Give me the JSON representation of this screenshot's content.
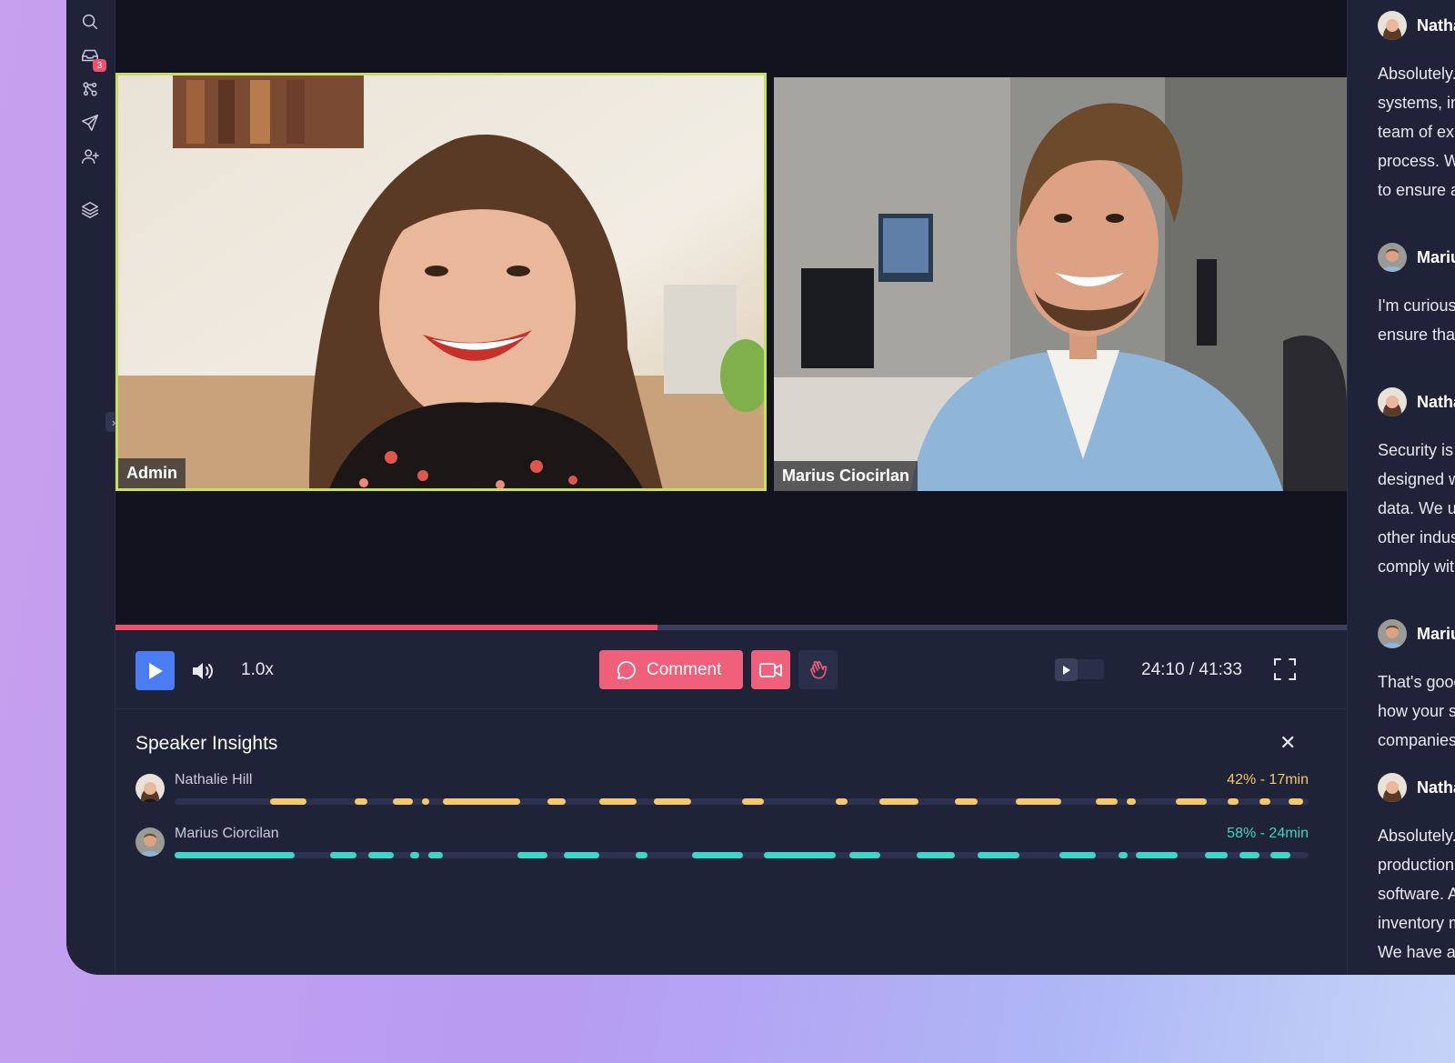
{
  "rail": {
    "inbox_badge": "3"
  },
  "video": {
    "participants": [
      {
        "name": "Admin"
      },
      {
        "name": "Marius Ciocirlan"
      }
    ],
    "progress": 0.44
  },
  "controls": {
    "speed": "1.0x",
    "comment_label": "Comment",
    "time": "24:10 / 41:33"
  },
  "insights": {
    "title": "Speaker Insights",
    "speakers": [
      {
        "name": "Nathalie Hill",
        "stat": "42% - 17min",
        "color": "#f5c869",
        "segments": [
          [
            105,
            145
          ],
          [
            198,
            212
          ],
          [
            240,
            262
          ],
          [
            272,
            280
          ],
          [
            295,
            380
          ],
          [
            410,
            430
          ],
          [
            467,
            508
          ],
          [
            527,
            568
          ],
          [
            624,
            648
          ],
          [
            727,
            740
          ],
          [
            775,
            818
          ],
          [
            858,
            883
          ],
          [
            925,
            975
          ],
          [
            1013,
            1037
          ],
          [
            1047,
            1057
          ],
          [
            1101,
            1135
          ],
          [
            1158,
            1170
          ],
          [
            1193,
            1205
          ],
          [
            1225,
            1241
          ]
        ]
      },
      {
        "name": "Marius Ciorcilan",
        "stat": "58% - 24min",
        "color": "#3ed6c4",
        "segments": [
          [
            0,
            132
          ],
          [
            171,
            200
          ],
          [
            213,
            241
          ],
          [
            259,
            269
          ],
          [
            279,
            295
          ],
          [
            377,
            410
          ],
          [
            428,
            467
          ],
          [
            507,
            520
          ],
          [
            569,
            625
          ],
          [
            648,
            727
          ],
          [
            742,
            776
          ],
          [
            816,
            858
          ],
          [
            883,
            929
          ],
          [
            973,
            1013
          ],
          [
            1038,
            1048
          ],
          [
            1057,
            1103
          ],
          [
            1133,
            1158
          ],
          [
            1171,
            1193
          ],
          [
            1205,
            1227
          ]
        ]
      }
    ]
  },
  "chat": {
    "messages": [
      {
        "author": "Nathalie Hill",
        "lines": [
          "Absolutely. We offer seamless integration with popular",
          "systems, including your existing ERP and CRM tools. Our",
          "team of experts will guide you through the entire",
          "process. We also provide dedicated support and training",
          "to ensure a smooth transition for your team."
        ]
      },
      {
        "author": "Marius Ciocirlan",
        "lines": [
          "I'm curious about security. How do you",
          "ensure that our production data stays protected?"
        ]
      },
      {
        "author": "Nathalie Hill",
        "lines": [
          "Security is our top priority. Our platform is",
          "designed with strong protection of your sensitive",
          "data. We use encryption, access controls and",
          "other industry-standard practices, and we",
          "comply with all major regulations."
        ]
      },
      {
        "author": "Marius Ciocirlan",
        "lines": [
          "That's good to hear. Could you share some examples of",
          "how your software has helped similar manufacturing",
          "companies?"
        ]
      },
      {
        "author": "Nathalie Hill",
        "lines": [
          "Absolutely. Several manufacturing companies improved",
          "production efficiency after adopting our",
          "software. A client reduced costs through better",
          "inventory management and streamlined operations.",
          "We have a detailed case study we can share."
        ]
      }
    ]
  }
}
